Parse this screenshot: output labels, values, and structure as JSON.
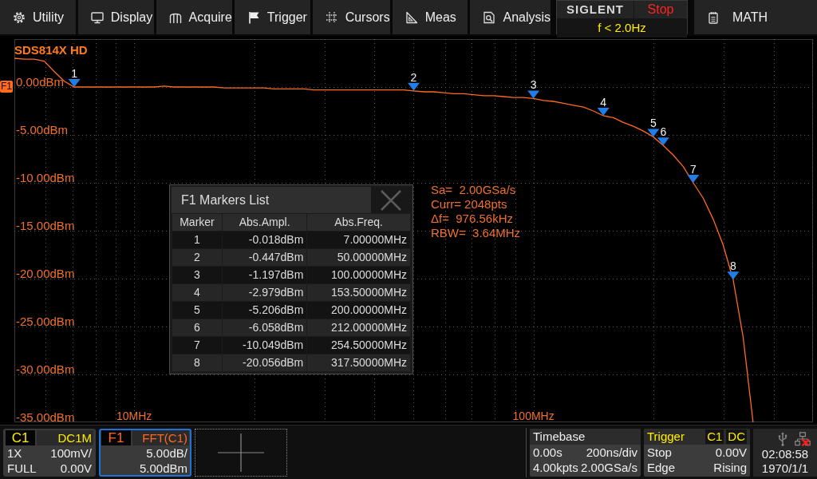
{
  "menu": [
    "Utility",
    "Display",
    "Acquire",
    "Trigger",
    "Cursors",
    "Meas",
    "Analysis"
  ],
  "status_panel": {
    "brand": "SIGLENT",
    "run_state": "Stop",
    "trigger_frequency": "f < 2.0Hz"
  },
  "math_button": "MATH",
  "screen": {
    "model": "SDS814X HD",
    "fft_info": [
      "Sa=  2.00GSa/s",
      "Curr= 2048pts",
      "Δf=  976.56kHz",
      "RBW=  3.64MHz"
    ],
    "chart_data": {
      "type": "line",
      "grid": true,
      "ylim": [
        -35,
        5
      ],
      "categories": [
        null,
        null,
        null,
        null,
        null,
        null,
        null,
        null,
        null,
        null,
        null,
        null,
        "10MHz",
        null,
        null,
        null,
        null,
        null,
        null,
        null,
        null,
        null,
        null,
        null,
        null,
        null,
        null,
        null,
        null,
        null,
        null,
        null,
        null,
        null,
        null,
        null,
        null,
        null,
        null,
        null,
        null,
        null,
        null,
        null,
        null,
        null,
        null,
        null,
        null,
        null,
        null,
        null,
        "100MHz",
        null,
        null,
        null,
        null,
        null,
        null,
        null,
        null,
        null,
        null,
        null,
        null,
        null,
        null,
        null,
        null,
        null,
        null,
        null,
        null,
        null,
        null,
        null,
        null,
        null,
        null,
        null,
        null
      ],
      "series": [
        {
          "name": "F1",
          "color": "#ff6a1f",
          "values": [
            3.0,
            2.9,
            2.9,
            2.7,
            1.6,
            0.6,
            0.0,
            0.0,
            0.0,
            0.0,
            0.0,
            0.0,
            0.0,
            0.0,
            0.0,
            0.1,
            0.0,
            0.0,
            0.0,
            0.0,
            0.0,
            -0.1,
            -0.1,
            -0.1,
            -0.1,
            -0.1,
            -0.2,
            -0.2,
            -0.2,
            -0.2,
            -0.3,
            -0.3,
            -0.3,
            -0.3,
            -0.3,
            -0.3,
            -0.3,
            -0.3,
            -0.3,
            -0.3,
            -0.4,
            -0.5,
            -0.5,
            -0.6,
            -0.7,
            -0.7,
            -0.8,
            -0.9,
            -0.9,
            -1.0,
            -1.1,
            -1.1,
            -1.2,
            -1.4,
            -1.5,
            -1.7,
            -1.9,
            -2.1,
            -2.5,
            -3.0,
            -3.2,
            -3.7,
            -4.1,
            -4.6,
            -5.2,
            -6.1,
            -7.1,
            -8.3,
            -10.0,
            -11.6,
            -13.8,
            -16.5,
            -20.1,
            -26.1,
            -35.0,
            null,
            null,
            null,
            null,
            null,
            null
          ]
        }
      ],
      "yticks": [
        {
          "value": 0,
          "label": "0.00dBm"
        },
        {
          "value": -5,
          "label": "-5.00dBm"
        },
        {
          "value": -10,
          "label": "-10.00dBm"
        },
        {
          "value": -15,
          "label": "-15.00dBm"
        },
        {
          "value": -20,
          "label": "-20.00dBm"
        },
        {
          "value": -25,
          "label": "-25.00dBm"
        },
        {
          "value": -30,
          "label": "-30.00dBm"
        },
        {
          "value": -35,
          "label": "-35.00dBm"
        }
      ],
      "annotations": [
        {
          "text": "1",
          "y": 0.0
        },
        {
          "text": "2",
          "y": -0.4
        },
        {
          "text": "3",
          "y": -1.2
        },
        {
          "text": "4",
          "y": -3.0
        },
        {
          "text": "5",
          "y": -5.2
        },
        {
          "text": "6",
          "y": -6.1
        },
        {
          "text": "7",
          "y": -10.0
        },
        {
          "text": "8",
          "y": -20.1
        }
      ]
    }
  },
  "markers_list": {
    "title": "F1 Markers List",
    "columns": [
      "Marker",
      "Abs.Ampl.",
      "Abs.Freq."
    ],
    "rows": [
      [
        "1",
        "-0.018dBm",
        "7.00000MHz"
      ],
      [
        "2",
        "-0.447dBm",
        "50.00000MHz"
      ],
      [
        "3",
        "-1.197dBm",
        "100.00000MHz"
      ],
      [
        "4",
        "-2.979dBm",
        "153.50000MHz"
      ],
      [
        "5",
        "-5.206dBm",
        "200.00000MHz"
      ],
      [
        "6",
        "-6.058dBm",
        "212.00000MHz"
      ],
      [
        "7",
        "-10.049dBm",
        "254.50000MHz"
      ],
      [
        "8",
        "-20.056dBm",
        "317.50000MHz"
      ]
    ]
  },
  "channels": [
    {
      "kind": "analog",
      "name": "C1",
      "info": "DC1M",
      "rows": [
        [
          "1X",
          "100mV/"
        ],
        [
          "FULL",
          "0.00V"
        ]
      ],
      "selected": false
    },
    {
      "kind": "math",
      "name": "F1",
      "info": "FFT(C1)",
      "rows": [
        [
          "5.00dB/"
        ],
        [
          "5.00dBm"
        ]
      ],
      "selected": true
    }
  ],
  "timebase": {
    "title": "Timebase",
    "rows": [
      [
        "0.00s",
        "200ns/div"
      ],
      [
        "4.00kpts",
        "2.00GSa/s"
      ]
    ]
  },
  "trigger": {
    "title": "Trigger",
    "source": "C1",
    "coupling": "DC",
    "rows": [
      [
        "Stop",
        "0.00V"
      ],
      [
        "Edge",
        "Rising"
      ]
    ]
  },
  "status": {
    "network_connected": false,
    "time": "02:08:58",
    "date": "1970/1/1"
  }
}
